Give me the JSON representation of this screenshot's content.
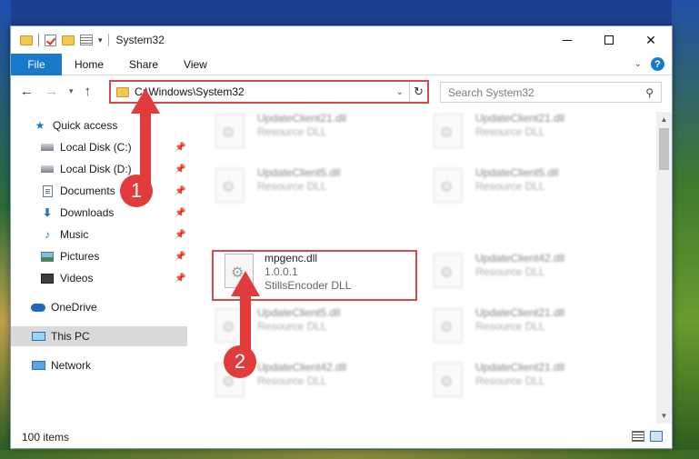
{
  "window": {
    "title": "System32",
    "minimize_label": "Minimize",
    "maximize_label": "Maximize",
    "close_glyph": "✕"
  },
  "ribbon": {
    "tabs": [
      "File",
      "Home",
      "Share",
      "View"
    ],
    "help_glyph": "?",
    "expand_glyph": "⌄"
  },
  "address": {
    "path": "C:\\Windows\\System32",
    "search_placeholder": "Search System32"
  },
  "sidebar": {
    "items": [
      {
        "label": "Quick access",
        "icon": "star-icon",
        "pinned": false
      },
      {
        "label": "Local Disk (C:)",
        "icon": "disk-icon",
        "pinned": true
      },
      {
        "label": "Local Disk (D:)",
        "icon": "disk-icon",
        "pinned": true
      },
      {
        "label": "Documents",
        "icon": "documents-icon",
        "pinned": true
      },
      {
        "label": "Downloads",
        "icon": "downloads-icon",
        "pinned": true
      },
      {
        "label": "Music",
        "icon": "music-icon",
        "pinned": true
      },
      {
        "label": "Pictures",
        "icon": "pictures-icon",
        "pinned": true
      },
      {
        "label": "Videos",
        "icon": "videos-icon",
        "pinned": true
      },
      {
        "label": "OneDrive",
        "icon": "onedrive-icon",
        "pinned": false
      },
      {
        "label": "This PC",
        "icon": "this-pc-icon",
        "pinned": false,
        "selected": true
      },
      {
        "label": "Network",
        "icon": "network-icon",
        "pinned": false
      }
    ]
  },
  "files": [
    {
      "name": "UpdateClient21.dll",
      "desc": "Resource DLL"
    },
    {
      "name": "UpdateClient21.dll",
      "desc": "Resource DLL"
    },
    {
      "name": "UpdateClient5.dll",
      "desc": "Resource DLL"
    },
    {
      "name": "UpdateClient5.dll",
      "desc": "Resource DLL"
    },
    {
      "name": "mpgenc.dll",
      "version": "1.0.0.1",
      "desc": "StillsEncoder DLL"
    },
    {
      "name": "UpdateClient42.dll",
      "desc": "Resource DLL"
    },
    {
      "name": "UpdateClient5.dll",
      "desc": "Resource DLL"
    },
    {
      "name": "UpdateClient21.dll",
      "desc": "Resource DLL"
    },
    {
      "name": "UpdateClient42.dll",
      "desc": "Resource DLL"
    },
    {
      "name": "UpdateClient21.dll",
      "desc": "Resource DLL"
    }
  ],
  "status": {
    "item_count": "100 items"
  },
  "annotations": {
    "step1": "1",
    "step2": "2"
  },
  "colors": {
    "accent": "#1979ca",
    "annotation_red": "#d84a4a"
  }
}
